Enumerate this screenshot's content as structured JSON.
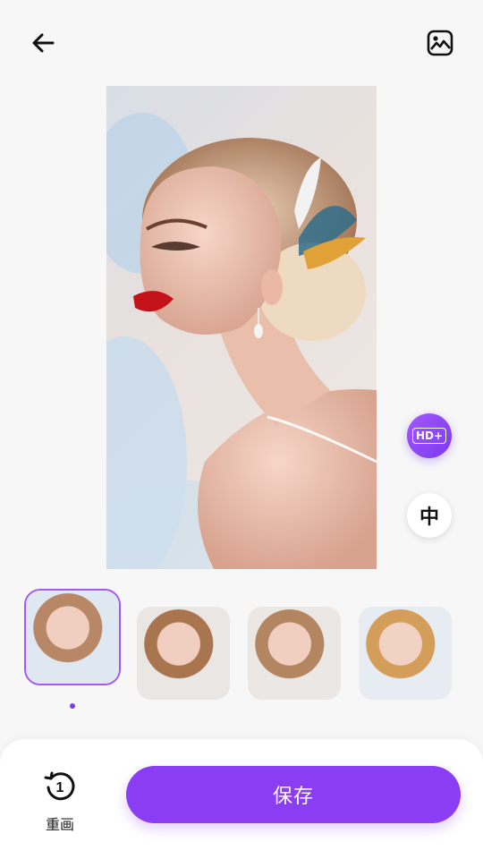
{
  "header": {
    "back_icon": "arrow-left-icon",
    "gallery_icon": "image-icon"
  },
  "side_buttons": {
    "hd_label": "HD+",
    "lang_label": "中"
  },
  "thumbnails": [
    {
      "name": "thumb-1",
      "selected": true
    },
    {
      "name": "thumb-2",
      "selected": false
    },
    {
      "name": "thumb-3",
      "selected": false
    },
    {
      "name": "thumb-4",
      "selected": false
    }
  ],
  "bottom": {
    "redraw_label": "重画",
    "redraw_icon": "history-icon",
    "save_label": "保存"
  },
  "colors": {
    "accent": "#8a3df3",
    "background": "#f7f7f7",
    "panel": "#ffffff"
  }
}
